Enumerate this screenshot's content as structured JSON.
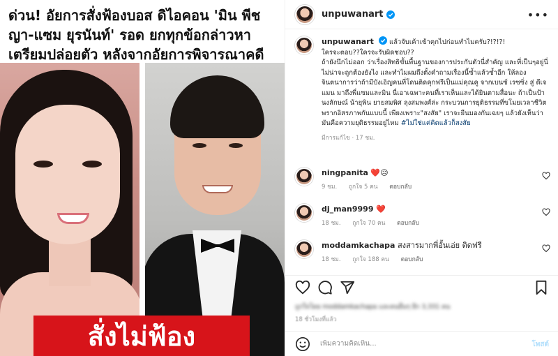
{
  "post": {
    "headline": "ด่วน! อัยการสั่งฟ้องบอส ดิไอคอน 'มิน พีชญา-แซม ยุรนันท์' รอด ยกทุกข้อกล่าวหา เตรียมปล่อยตัว หลังจากอัยการพิจารณาคดี",
    "banner_text": "สั่งไม่ฟ้อง"
  },
  "header": {
    "username": "unpuwanart",
    "more_icon": "more-horizontal-icon"
  },
  "caption": {
    "username": "unpuwanart",
    "line1": "แล้วจับเค้าเข้าคุกไปก่อนทำไมครับ?!?!?!",
    "line2": "ใครจะตอบ??ใครจะรับผิดชอบ??",
    "line3": "ถ้ายังนึกไม่ออก ว่าเรื่องสิทธิขั้นพื้นฐานของการประกันตัวนี่สำคัญ และที่เป็นๆอยู่นี่ไม่น่าจะถูกต้องยังไง และทำไมผมถึงตั้งคำถามเรื่องนี้ซ้ำแล้วซ้ำอีก ให้ลองจินตนาการว่าถ้ามีบังเอิญคนที่โดนติดคุกฟรีเป็นแม่คุณคู จากเบนซ์ เรซซิ่ง สู่ ดีเจแมน มาถึงพี่แซมและมิน นี่เอาเฉพาะคนที่เราเห็นและได้ยินตามสื่อนะ ถ้าเป็นป้านงลักษณ์ น้ายุพิน ยายสมพิศ ลุงสมพงศ์ล่ะ กระบวนการยุติธรรมที่ขโมยเวลาชีวิต พรากอิสรภาพกันแบบนี้ เพียงเพราะ\"สงสัย\" เราจะยืนมองกันเฉยๆ แล้วยังเห็นว่ามันคือความยุติธรรมอยู่ไหม",
    "hashtag": "#ไม่ใช่แค่คิดแล้วก็สงสัย",
    "meta": "มีการแก้ไข · 17 ชม."
  },
  "comments": [
    {
      "username": "ningpanita",
      "text": "❤️😥",
      "time": "9 ชม.",
      "likes": "ถูกใจ 5 คน",
      "reply": "ตอบกลับ"
    },
    {
      "username": "dj_man9999",
      "text": "❤️",
      "time": "18 ชม.",
      "likes": "ถูกใจ 70 คน",
      "reply": "ตอบกลับ"
    },
    {
      "username": "moddamkachapa",
      "text": "สงสารมากพี่อั้นเอ่ย ติดฟรี",
      "time": "18 ชม.",
      "likes": "ถูกใจ 188 คน",
      "reply": "ตอบกลับ"
    }
  ],
  "actions": {
    "like_icon": "heart-icon",
    "comment_icon": "comment-icon",
    "share_icon": "send-icon",
    "save_icon": "bookmark-icon"
  },
  "likes_text": "ถูกใจโดย moddamkachapa และคนอื่นๆ อีก 3,331 คน",
  "post_time": "18 ชั่วโมงที่แล้ว",
  "add_comment": {
    "placeholder": "เพิ่มความคิดเห็น...",
    "post_label": "โพสต์",
    "emoji_icon": "emoji-icon"
  },
  "colors": {
    "banner_red": "#d7141a",
    "verified_blue": "#0095f6",
    "heart_red": "#ed4956",
    "hashtag_blue": "#00376b"
  }
}
